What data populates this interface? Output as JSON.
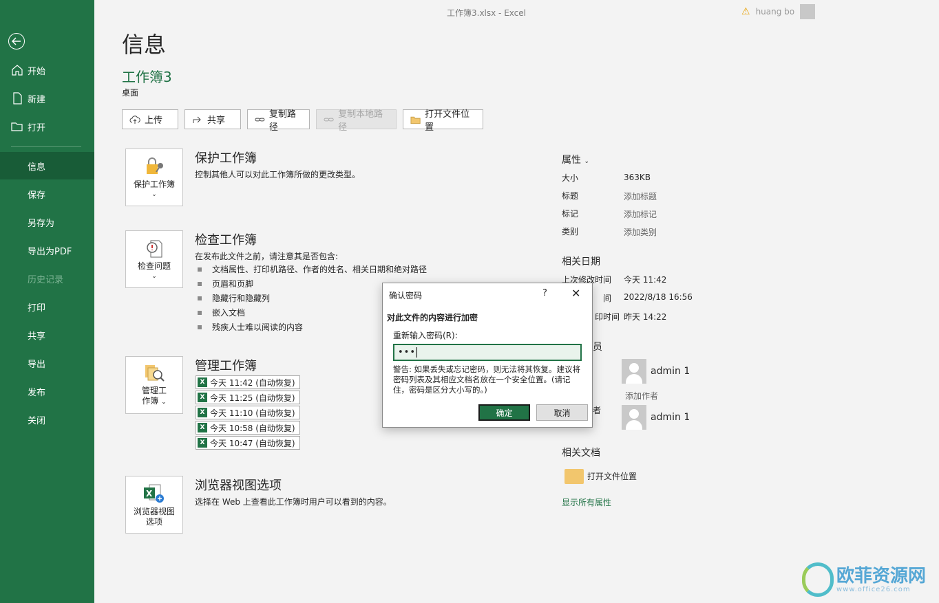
{
  "window": {
    "title": "工作簿3.xlsx  -  Excel",
    "user": "huang bo"
  },
  "sidebar": {
    "items": [
      {
        "label": "开始",
        "icon": "home-icon"
      },
      {
        "label": "新建",
        "icon": "new-doc-icon"
      },
      {
        "label": "打开",
        "icon": "folder-open-icon"
      },
      {
        "label": "信息",
        "active": true
      },
      {
        "label": "保存"
      },
      {
        "label": "另存为"
      },
      {
        "label": "导出为PDF"
      },
      {
        "label": "历史记录",
        "disabled": true
      },
      {
        "label": "打印"
      },
      {
        "label": "共享"
      },
      {
        "label": "导出"
      },
      {
        "label": "发布"
      },
      {
        "label": "关闭"
      }
    ]
  },
  "info": {
    "title": "信息",
    "workbook_name": "工作簿3",
    "location": "桌面",
    "toolbar": {
      "upload": "上传",
      "share": "共享",
      "copy_path": "复制路径",
      "copy_local_path": "复制本地路径",
      "open_location": "打开文件位置"
    },
    "protect": {
      "button": "保护工作簿",
      "title": "保护工作簿",
      "desc": "控制其他人可以对此工作簿所做的更改类型。"
    },
    "inspect": {
      "button": "检查问题",
      "title": "检查工作簿",
      "desc": "在发布此文件之前，请注意其是否包含:",
      "bullets": [
        "文档属性、打印机路径、作者的姓名、相关日期和绝对路径",
        "页眉和页脚",
        "隐藏行和隐藏列",
        "嵌入文档",
        "残疾人士难以阅读的内容"
      ]
    },
    "manage": {
      "button_line1": "管理工",
      "button_line2": "作簿",
      "title": "管理工作簿",
      "versions": [
        "今天 11:42 (自动恢复)",
        "今天 11:25 (自动恢复)",
        "今天 11:10 (自动恢复)",
        "今天 10:58 (自动恢复)",
        "今天 10:47 (自动恢复)"
      ]
    },
    "browser": {
      "button_line1": "浏览器视图",
      "button_line2": "选项",
      "title": "浏览器视图选项",
      "desc": "选择在 Web 上查看此工作簿时用户可以看到的内容。"
    }
  },
  "properties": {
    "header": "属性",
    "size_label": "大小",
    "size_value": "363KB",
    "title_label": "标题",
    "title_value": "添加标题",
    "tags_label": "标记",
    "tags_value": "添加标记",
    "category_label": "类别",
    "category_value": "添加类别",
    "dates_header": "相关日期",
    "modified_label": "上次修改时间",
    "modified_value": "今天 11:42",
    "created_label_partial": "间",
    "created_value": "2022/8/18 16:56",
    "printed_label_partial": "印时间",
    "printed_value": "昨天 14:22",
    "people_header_partial": "员",
    "author_name": "admin 1",
    "add_author": "添加作者",
    "modifier_label_partial": "者",
    "modifier_name": "admin 1",
    "docs_header": "相关文档",
    "open_location": "打开文件位置",
    "show_all": "显示所有属性"
  },
  "dialog": {
    "title": "确认密码",
    "help": "?",
    "close": "✕",
    "heading": "对此文件的内容进行加密",
    "label": "重新输入密码(R):",
    "value": "•••",
    "warning": "警告: 如果丢失或忘记密码，则无法将其恢复。建议将密码列表及其相应文档名放在一个安全位置。(请记住，密码是区分大小写的。)",
    "ok": "确定",
    "cancel": "取消"
  },
  "watermark": {
    "name": "欧菲资源网",
    "url": "www.office26.com"
  }
}
